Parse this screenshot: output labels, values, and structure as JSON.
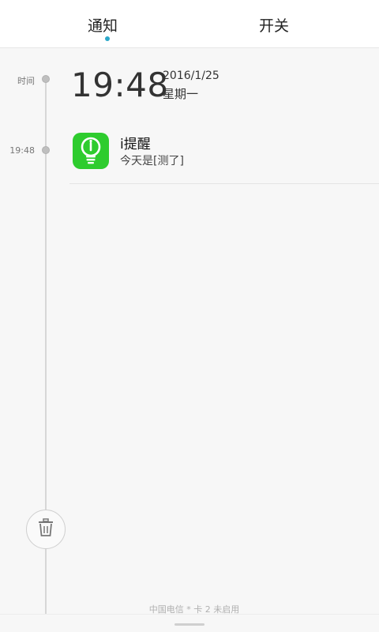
{
  "tabs": [
    {
      "label": "通知",
      "active": true
    },
    {
      "label": "开关",
      "active": false
    }
  ],
  "timeline": {
    "header_label": "时间",
    "clock": "19:48",
    "date": "2016/1/25",
    "weekday": "星期一"
  },
  "notifications": [
    {
      "time": "19:48",
      "app": "i提醒",
      "message": "今天是[测了]",
      "icon": "lightbulb-icon",
      "icon_color": "#2ecc2e"
    }
  ],
  "footer": {
    "carrier": "中国电信 * 卡 2 未启用",
    "delete_icon": "trash-icon"
  },
  "colors": {
    "accent": "#2aa7c9"
  }
}
